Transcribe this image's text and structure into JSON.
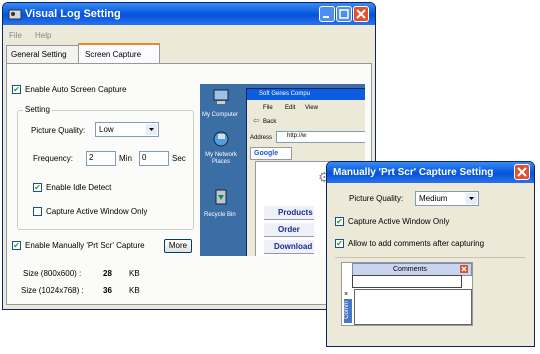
{
  "main_window": {
    "title": "Visual Log Setting",
    "menu": [
      "File",
      "Help"
    ],
    "tabs": [
      "General Setting",
      "Screen Capture"
    ],
    "enable_auto_capture": {
      "label": "Enable Auto Screen Capture",
      "checked": true
    },
    "setting_group": "Setting",
    "picture_quality": {
      "label": "Picture Quality:",
      "value": "Low"
    },
    "frequency": {
      "label": "Frequency:",
      "min_value": "2",
      "min_unit": "Min",
      "sec_value": "0",
      "sec_unit": "Sec"
    },
    "idle_detect": {
      "label": "Enable Idle Detect",
      "checked": true
    },
    "active_window": {
      "label": "Capture Active Window Only",
      "checked": false
    },
    "enable_manual": {
      "label": "Enable Manually 'Prt Scr' Capture",
      "checked": true
    },
    "more_button": "More",
    "sizes": [
      {
        "label": "Size (800x600) :",
        "value": "28",
        "unit": "KB"
      },
      {
        "label": "Size (1024x768) :",
        "value": "36",
        "unit": "KB"
      }
    ]
  },
  "preview": {
    "desktop_icons": [
      "My Computer",
      "My Network Places",
      "Recycle Bin"
    ],
    "browser_title": "Soft Genes Compu",
    "browser_menu": [
      "File",
      "Edit",
      "View"
    ],
    "back_label": "Back",
    "address_label": "Address",
    "address_value": "http://w",
    "google_label": "Google",
    "nav_links": [
      "Products",
      "Order",
      "Download"
    ]
  },
  "manual_dialog": {
    "title": "Manually 'Prt Scr' Capture Setting",
    "picture_quality": {
      "label": "Picture Quality:",
      "value": "Medium"
    },
    "active_window": {
      "label": "Capture Active Window Only",
      "checked": true
    },
    "allow_comments": {
      "label": "Allow to add comments after capturing",
      "checked": true
    },
    "comments_title": "Comments",
    "comments_side": "Comm"
  },
  "colors": {
    "titlebar": "#0a5ce0",
    "window_bg": "#ece9d8",
    "desktop": "#3a6ea5",
    "close_btn": "#e0512f",
    "link": "#1a2f8a"
  }
}
